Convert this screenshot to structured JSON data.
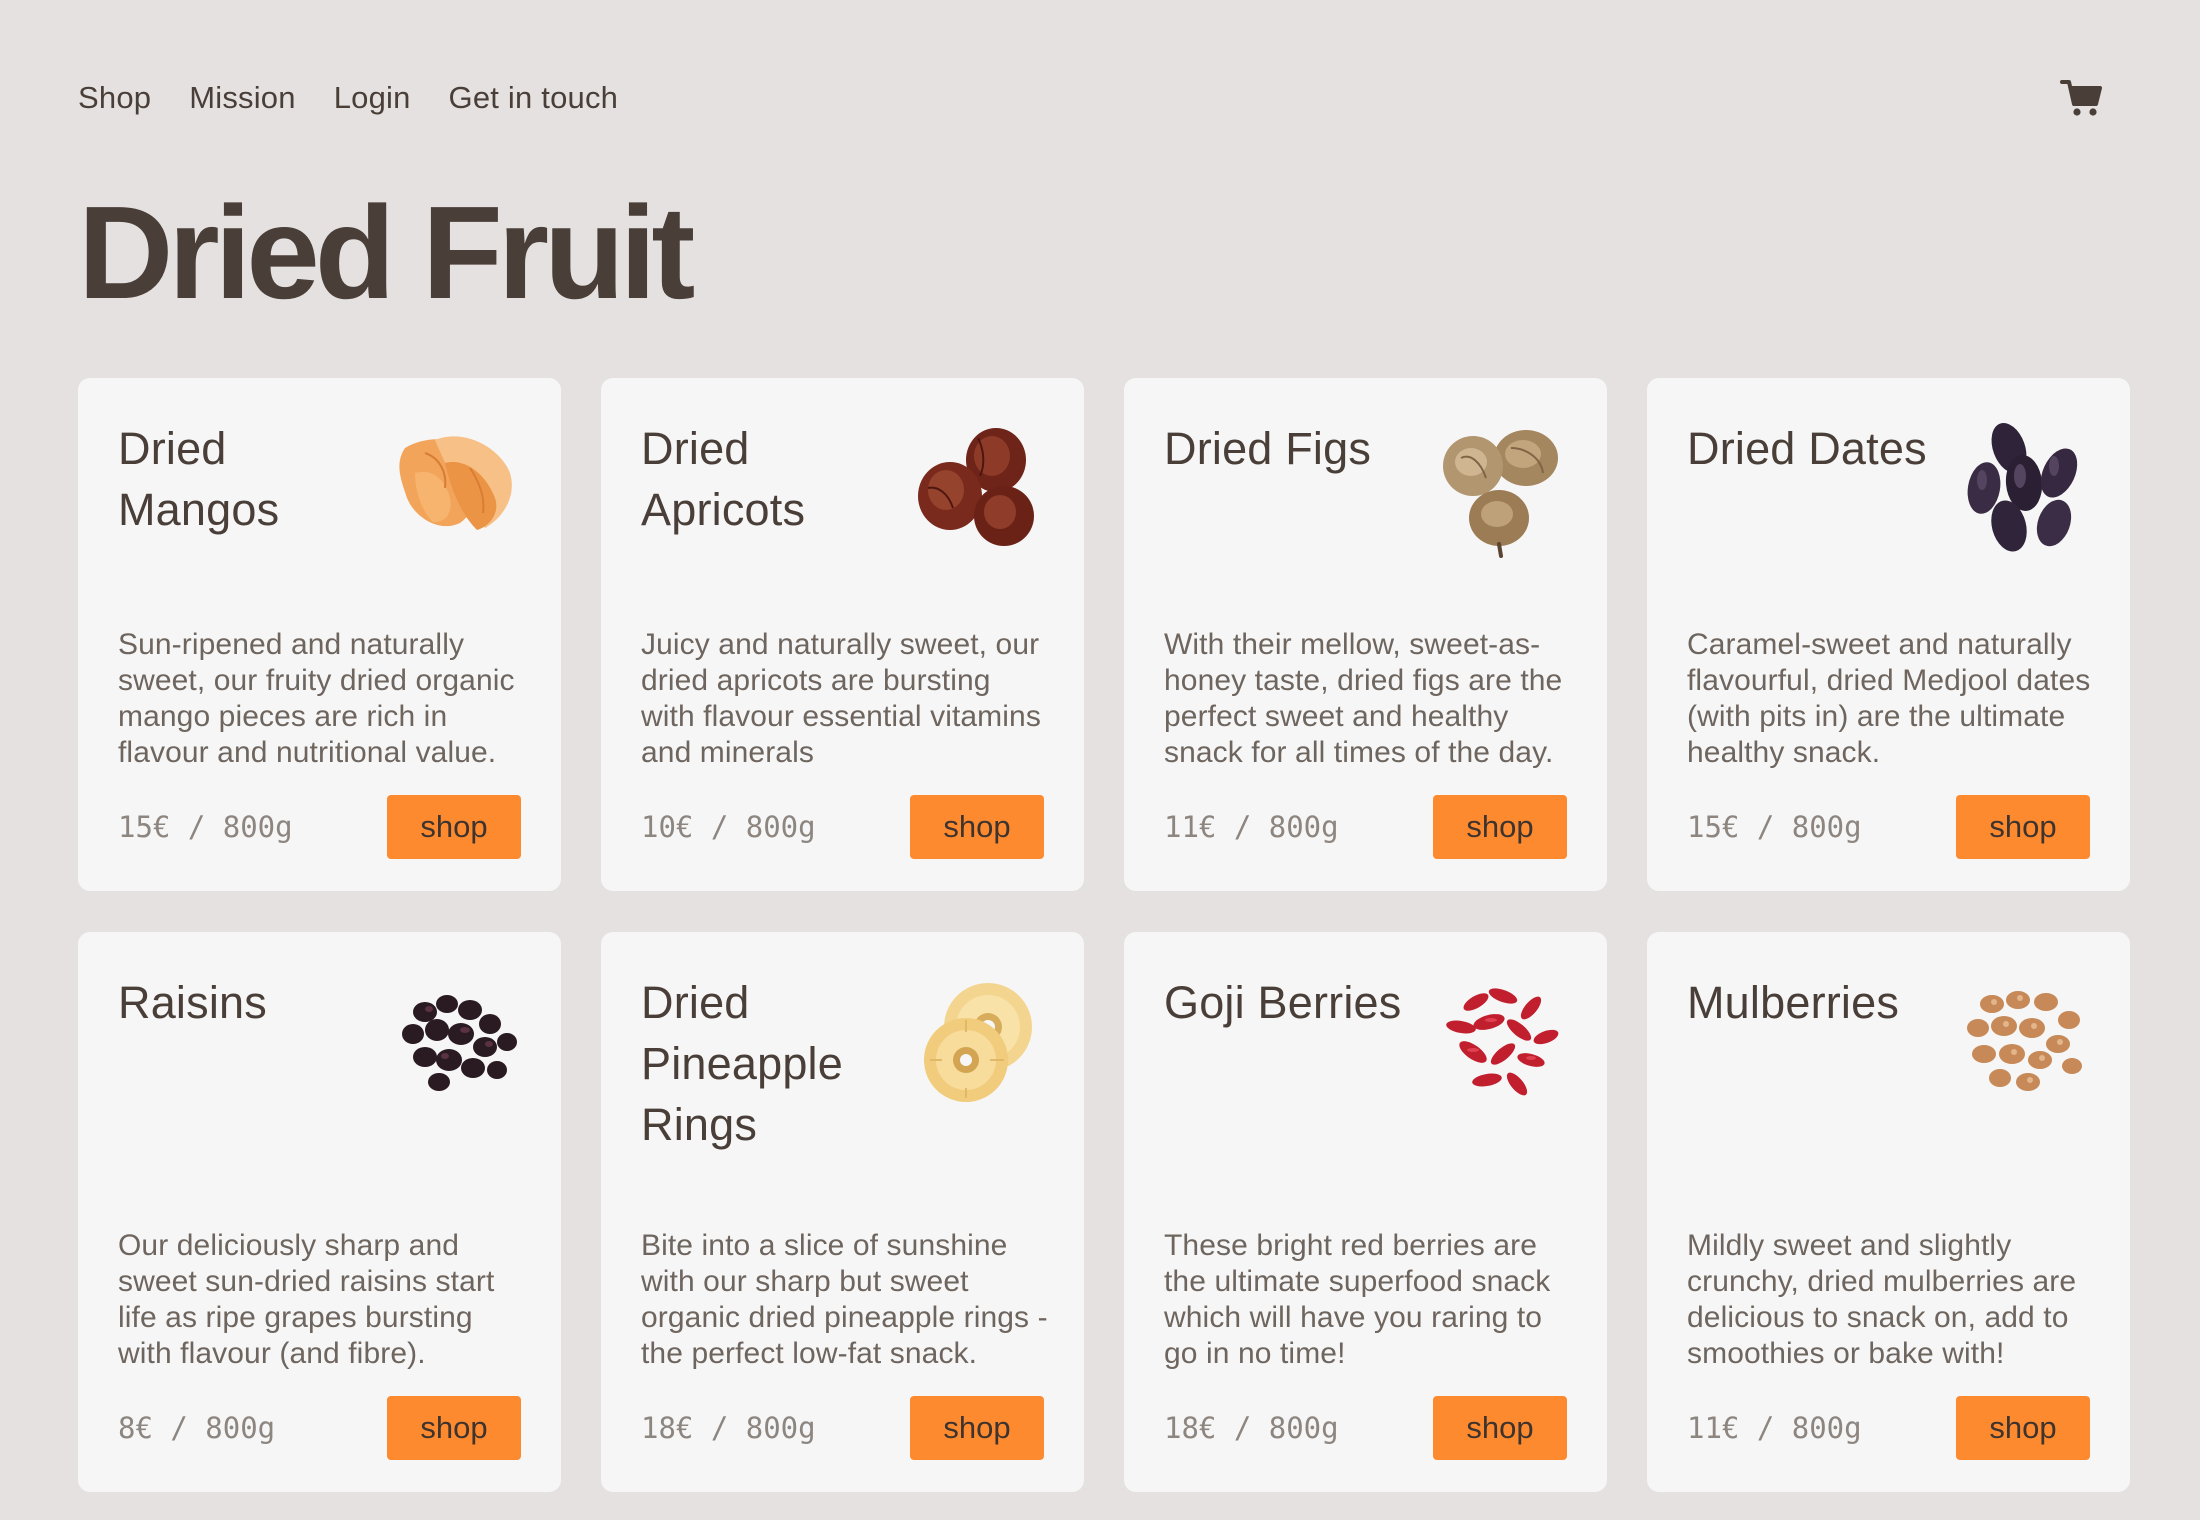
{
  "nav": {
    "items": [
      "Shop",
      "Mission",
      "Login",
      "Get in touch"
    ],
    "cart_icon": "shopping-cart-icon"
  },
  "page": {
    "title": "Dried Fruit"
  },
  "colors": {
    "background": "#e4e1e0",
    "card": "#f6f6f6",
    "accent": "#fe8a30",
    "text": "#4a3f38",
    "muted": "#6e655f"
  },
  "products": [
    {
      "name": "Dried Mangos",
      "icon": "dried-mango-image",
      "description": "Sun-ripened and naturally sweet, our fruity dried organic mango pieces are rich in flavour and nutritional value.",
      "price": "15€ / 800g",
      "button": "shop"
    },
    {
      "name": "Dried Apricots",
      "icon": "dried-apricot-image",
      "description": "Juicy and naturally sweet, our dried apricots are bursting with flavour essential vitamins and minerals",
      "price": "10€ / 800g",
      "button": "shop"
    },
    {
      "name": "Dried Figs",
      "icon": "dried-fig-image",
      "description": "With their mellow, sweet-as-honey taste, dried figs are the perfect sweet and healthy snack for all times of the day.",
      "price": "11€ / 800g",
      "button": "shop"
    },
    {
      "name": "Dried Dates",
      "icon": "dried-date-image",
      "description": "Caramel-sweet and naturally flavourful, dried Medjool dates (with pits in) are the ultimate healthy snack.",
      "price": "15€ / 800g",
      "button": "shop"
    },
    {
      "name": "Raisins",
      "icon": "raisin-image",
      "description": "Our deliciously sharp and sweet sun-dried raisins start life as ripe grapes bursting with flavour (and fibre).",
      "price": "8€ / 800g",
      "button": "shop"
    },
    {
      "name": "Dried Pineapple Rings",
      "icon": "dried-pineapple-image",
      "description": "Bite into a slice of sunshine with our sharp but sweet organic dried pineapple rings - the perfect low-fat snack.",
      "price": "18€ / 800g",
      "button": "shop"
    },
    {
      "name": "Goji Berries",
      "icon": "goji-berry-image",
      "description": "These bright red berries are the ultimate superfood snack which will have you raring to go in no time!",
      "price": "18€ / 800g",
      "button": "shop"
    },
    {
      "name": "Mulberries",
      "icon": "mulberry-image",
      "description": "Mildly sweet and slightly crunchy, dried mulberries are delicious to snack on, add to smoothies or bake with!",
      "price": "11€ / 800g",
      "button": "shop"
    }
  ]
}
